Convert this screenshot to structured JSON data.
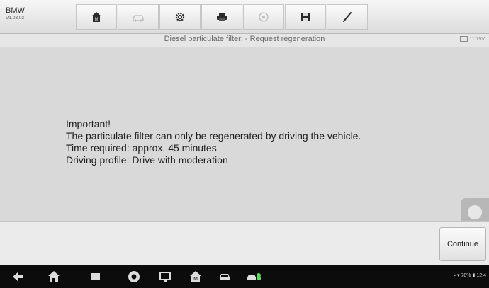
{
  "header": {
    "brand": "BMW",
    "version": "V1.03.03"
  },
  "toolbar": {
    "buttons": [
      {
        "icon": "home-icon"
      },
      {
        "icon": "vehicle-swap-icon"
      },
      {
        "icon": "settings-icon"
      },
      {
        "icon": "print-icon"
      },
      {
        "icon": "help-icon"
      },
      {
        "icon": "save-icon"
      },
      {
        "icon": "pen-icon"
      }
    ]
  },
  "titlebar": {
    "title": "Diesel particulate filter: - Request regeneration",
    "voltage": "11.79V"
  },
  "message": {
    "heading": "Important!",
    "line1": "The particulate filter can only be regenerated by driving the vehicle.",
    "line2": "Time required: approx. 45 minutes",
    "line3": "Driving profile: Drive with moderation"
  },
  "footer": {
    "continue_label": "Continue"
  },
  "navbar": {
    "icons": [
      "back-icon",
      "home-icon",
      "recent-apps-icon",
      "chrome-icon",
      "screenshot-icon",
      "autel-icon",
      "car-icon",
      "vci-icon"
    ],
    "status": "78%",
    "time": "12:4"
  },
  "colors": {
    "content_bg": "#d9d9d9",
    "navbar_bg": "#0c0c0c",
    "toolbar_bg": "#e9e9e9"
  }
}
